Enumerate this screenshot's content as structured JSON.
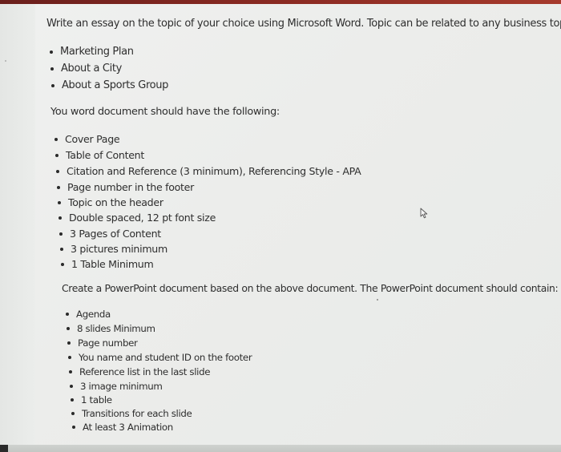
{
  "assignment": {
    "intro": "Write an essay on the topic of your choice using Microsoft Word. Topic can be related to any business topic.",
    "topic_options": [
      "Marketing Plan",
      "About a City",
      "About a Sports Group"
    ],
    "word_requirements_intro": "You word document should have the following:",
    "word_requirements": [
      "Cover Page",
      "Table of Content",
      "Citation and Reference (3 minimum), Referencing Style - APA",
      "Page number in the footer",
      "Topic on the header",
      "Double spaced, 12 pt font size",
      "3 Pages of Content",
      "3 pictures minimum",
      "1 Table Minimum"
    ],
    "powerpoint_requirements_intro": "Create a PowerPoint document based on the above document. The PowerPoint document should contain:",
    "powerpoint_requirements": [
      "Agenda",
      "8 slides Minimum",
      "Page number",
      "You name and student ID on the footer",
      "Reference list in the last slide",
      "3 image minimum",
      "1 table",
      "Transitions for each slide",
      "At least 3 Animation"
    ]
  },
  "colors": {
    "top_band": "#8a2a22",
    "page_background": "#eeefee",
    "text": "#2e2e2e"
  },
  "icons": {
    "cursor": "mouse-pointer-arrow"
  }
}
